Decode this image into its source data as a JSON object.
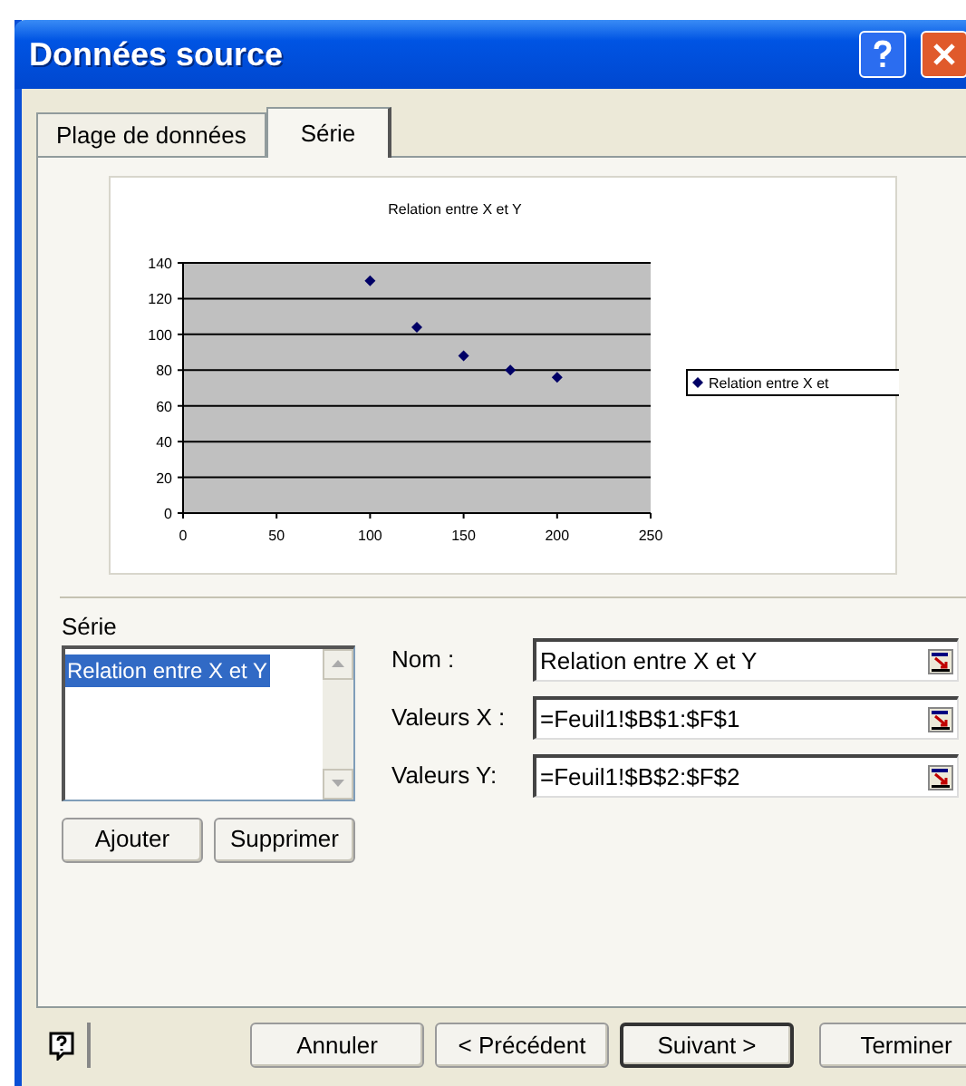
{
  "window": {
    "title": "Données source"
  },
  "tabs": [
    {
      "label": "Plage de données",
      "selected": false
    },
    {
      "label": "Série",
      "selected": true
    }
  ],
  "chart": {
    "chart_data": {
      "type": "scatter",
      "title": "Relation entre X et Y",
      "x": [
        100,
        125,
        150,
        175,
        200
      ],
      "series": [
        {
          "name": "Relation entre X et",
          "color": "#000066",
          "values": [
            130,
            104,
            88,
            80,
            76
          ]
        }
      ],
      "xlim": [
        0,
        250
      ],
      "ylim": [
        0,
        140
      ],
      "xticks": [
        0,
        50,
        100,
        150,
        200,
        250
      ],
      "yticks": [
        0,
        20,
        40,
        60,
        80,
        100,
        120,
        140
      ],
      "grid": true
    }
  },
  "series_list": {
    "label": "Série",
    "items": [
      {
        "label": "Relation entre X et Y",
        "selected": true
      }
    ]
  },
  "fields": [
    {
      "label": "Nom :",
      "value": "Relation entre X et Y"
    },
    {
      "label": "Valeurs X :",
      "value": "=Feuil1!$B$1:$F$1"
    },
    {
      "label": "Valeurs Y:",
      "value": "=Feuil1!$B$2:$F$2"
    }
  ],
  "series_buttons": [
    "Ajouter",
    "Supprimer"
  ],
  "footer_buttons": [
    {
      "label": "Annuler",
      "default": false
    },
    {
      "label": "< Précédent",
      "default": false
    },
    {
      "label": "Suivant >",
      "default": true
    },
    {
      "label": "Terminer",
      "default": false
    }
  ]
}
